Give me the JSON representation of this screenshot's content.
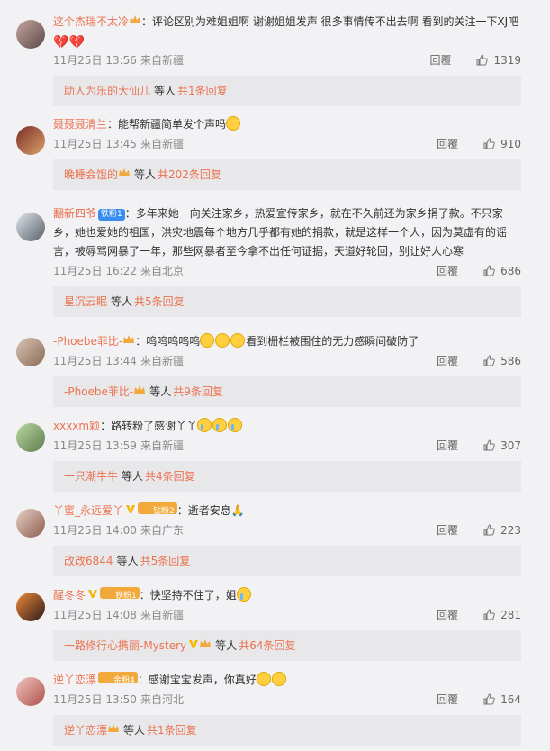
{
  "comments": [
    {
      "username": "这个杰瑞不太冷",
      "crown": true,
      "text": "：评论区别为难姐姐啊 谢谢姐姐发声 很多事情传不出去啊 看到的关注一下XJ吧",
      "emojis": [
        "broken-heart",
        "broken-heart"
      ],
      "time": "11月25日 13:56",
      "source": "来自新疆",
      "reply": "回覆",
      "likes": "1319",
      "sub_user": "助人为乐的大仙儿",
      "sub_text": "等人",
      "sub_count": "共1条回复"
    },
    {
      "username": "聂聂聂清兰",
      "text": "：能帮新疆简单发个声吗",
      "emojis": [
        "sad"
      ],
      "time": "11月25日 13:45",
      "source": "来自新疆",
      "reply": "回覆",
      "likes": "910",
      "sub_user": "晚睡会饿的",
      "sub_crown": true,
      "sub_text": "等人",
      "sub_count": "共202条回复"
    },
    {
      "username": "翻新四爷",
      "badge": "铁粉1",
      "badge_color": "blue",
      "text": "：多年来她一向关注家乡，热爱宣传家乡，就在不久前还为家乡捐了款。不只家乡，她也爱她的祖国，洪灾地震每个地方几乎都有她的捐款，就是这样一个人，因为莫虚有的谣言，被辱骂网暴了一年，那些网暴者至今拿不出任何证据，天道好轮回，别让好人心寒",
      "time": "11月25日 16:22",
      "source": "来自北京",
      "reply": "回覆",
      "likes": "686",
      "sub_user": "星沉云眠",
      "sub_text": "等人",
      "sub_count": "共5条回复"
    },
    {
      "username": "-Phoebe菲比-",
      "crown": true,
      "text_before": "：呜呜呜呜呜",
      "emojis": [
        "sad",
        "sad",
        "sad"
      ],
      "text": "看到栅栏被围住的无力感瞬间破防了",
      "time": "11月25日 13:44",
      "source": "来自新疆",
      "reply": "回覆",
      "likes": "586",
      "sub_user": "-Phoebe菲比-",
      "sub_crown": true,
      "sub_text": "等人",
      "sub_count": "共9条回复"
    },
    {
      "username": "xxxxm颖",
      "text": "：路转粉了感谢丫丫",
      "emojis": [
        "cry",
        "cry",
        "cry"
      ],
      "time": "11月25日 13:59",
      "source": "来自新疆",
      "reply": "回覆",
      "likes": "307",
      "sub_user": "一只潮牛牛",
      "sub_text": "等人",
      "sub_count": "共4条回复"
    },
    {
      "username": "丫蜜_永远爱丫",
      "vip": true,
      "badge": "钻粉2",
      "badge_color": "gold",
      "crown": true,
      "text": "：逝者安息🙏",
      "time": "11月25日 14:00",
      "source": "来自广东",
      "reply": "回覆",
      "likes": "223",
      "sub_user": "改改6844",
      "sub_text": "等人",
      "sub_count": "共5条回复"
    },
    {
      "username": "醒冬冬",
      "vip": true,
      "badge": "铁粉1",
      "badge_color": "gold",
      "crown": true,
      "text": "：快坚持不住了，姐",
      "emojis": [
        "cry"
      ],
      "time": "11月25日 14:08",
      "source": "来自新疆",
      "reply": "回覆",
      "likes": "281",
      "sub_user": "一路修行心携丽-Mystery",
      "sub_vip": true,
      "sub_crown": true,
      "sub_text": "等人",
      "sub_count": "共64条回复"
    },
    {
      "username": "逆丫恋漂",
      "badge": "金粉4",
      "badge_color": "gold",
      "crown": true,
      "text": "：感谢宝宝发声，你真好",
      "emojis": [
        "smile",
        "smile"
      ],
      "time": "11月25日 13:50",
      "source": "来自河北",
      "reply": "回覆",
      "likes": "164",
      "sub_user": "逆丫恋漂",
      "sub_crown": true,
      "sub_text": "等人",
      "sub_count": "共1条回复"
    }
  ],
  "icons": {
    "like": "thumbs-up-icon",
    "crown": "crown-icon",
    "vip": "vip-v-icon"
  },
  "colors": {
    "username": "#eb7350",
    "meta": "#8a8a8a",
    "subbox": "#e8e8eb",
    "background": "#f2f2f5"
  }
}
